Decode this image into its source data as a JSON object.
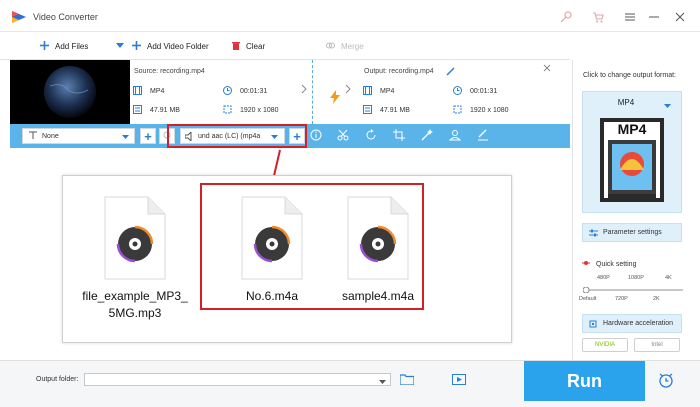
{
  "app": {
    "title": "Video Converter"
  },
  "toolbar": {
    "add_files": "Add Files",
    "add_video_folder": "Add Video Folder",
    "clear": "Clear",
    "merge": "Merge"
  },
  "file": {
    "source_label": "Source: recording.mp4",
    "output_label": "Output: recording.mp4",
    "source": {
      "format": "MP4",
      "duration": "00:01:31",
      "size": "47.91 MB",
      "resolution": "1920 x 1080"
    },
    "output": {
      "format": "MP4",
      "duration": "00:01:31",
      "size": "47.91 MB",
      "resolution": "1920 x 1080"
    }
  },
  "options": {
    "subtitle_value": "None",
    "audio_track_value": "und aac (LC) (mp4a"
  },
  "overlay": {
    "files": [
      {
        "name": "file_example_MP3_5MG.mp3"
      },
      {
        "name": "No.6.m4a"
      },
      {
        "name": "sample4.m4a"
      }
    ]
  },
  "right_panel": {
    "hint": "Click to change output format:",
    "format": "MP4",
    "format_art_label": "MP4",
    "parameter_settings": "Parameter settings",
    "quick_setting": "Quick setting",
    "ticks_top": [
      "480P",
      "1080P",
      "4K"
    ],
    "ticks_bottom": [
      "Default",
      "720P",
      "2K"
    ],
    "hardware_acceleration": "Hardware acceleration",
    "badges": [
      "NVIDIA",
      "Intel"
    ]
  },
  "bottom": {
    "output_folder_label": "Output folder:",
    "output_path": "",
    "run": "Run"
  },
  "colors": {
    "accent": "#2aa3ec",
    "highlight": "#d31f26",
    "bar": "#5ab4ea"
  }
}
